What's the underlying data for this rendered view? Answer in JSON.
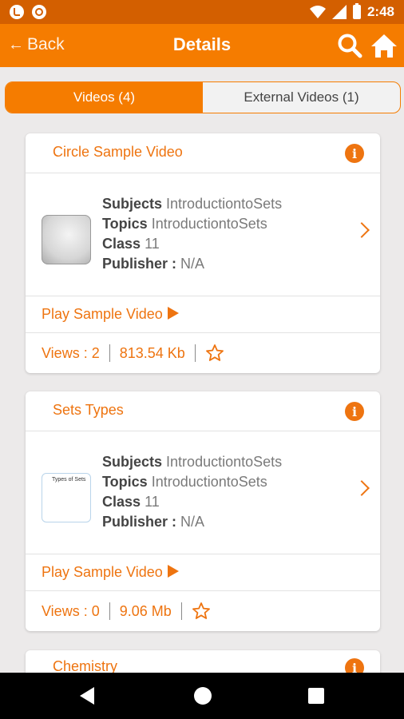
{
  "status_bar": {
    "time": "2:48"
  },
  "app_bar": {
    "back_label": "Back",
    "title": "Details"
  },
  "tabs": [
    {
      "label": "Videos (4)",
      "active": true
    },
    {
      "label": "External Videos (1)",
      "active": false
    }
  ],
  "videos": [
    {
      "title": "Circle Sample Video",
      "subjects_key": "Subjects",
      "subjects": "IntroductiontoSets",
      "topics_key": "Topics",
      "topics": "IntroductiontoSets",
      "class_key": "Class",
      "class": "11",
      "publisher_key": "Publisher :",
      "publisher": "N/A",
      "play_label": "Play Sample Video",
      "views": "Views : 2",
      "size": "813.54 Kb",
      "thumbnail_text": ""
    },
    {
      "title": "Sets Types",
      "subjects_key": "Subjects",
      "subjects": "IntroductiontoSets",
      "topics_key": "Topics",
      "topics": "IntroductiontoSets",
      "class_key": "Class",
      "class": "11",
      "publisher_key": "Publisher :",
      "publisher": "N/A",
      "play_label": "Play Sample Video",
      "views": "Views : 0",
      "size": "9.06 Mb",
      "thumbnail_text": "Types of Sets"
    },
    {
      "title": "Chemistry"
    }
  ],
  "colors": {
    "accent": "#f57c00",
    "status_bar": "#d35f00",
    "link": "#ee7410"
  }
}
